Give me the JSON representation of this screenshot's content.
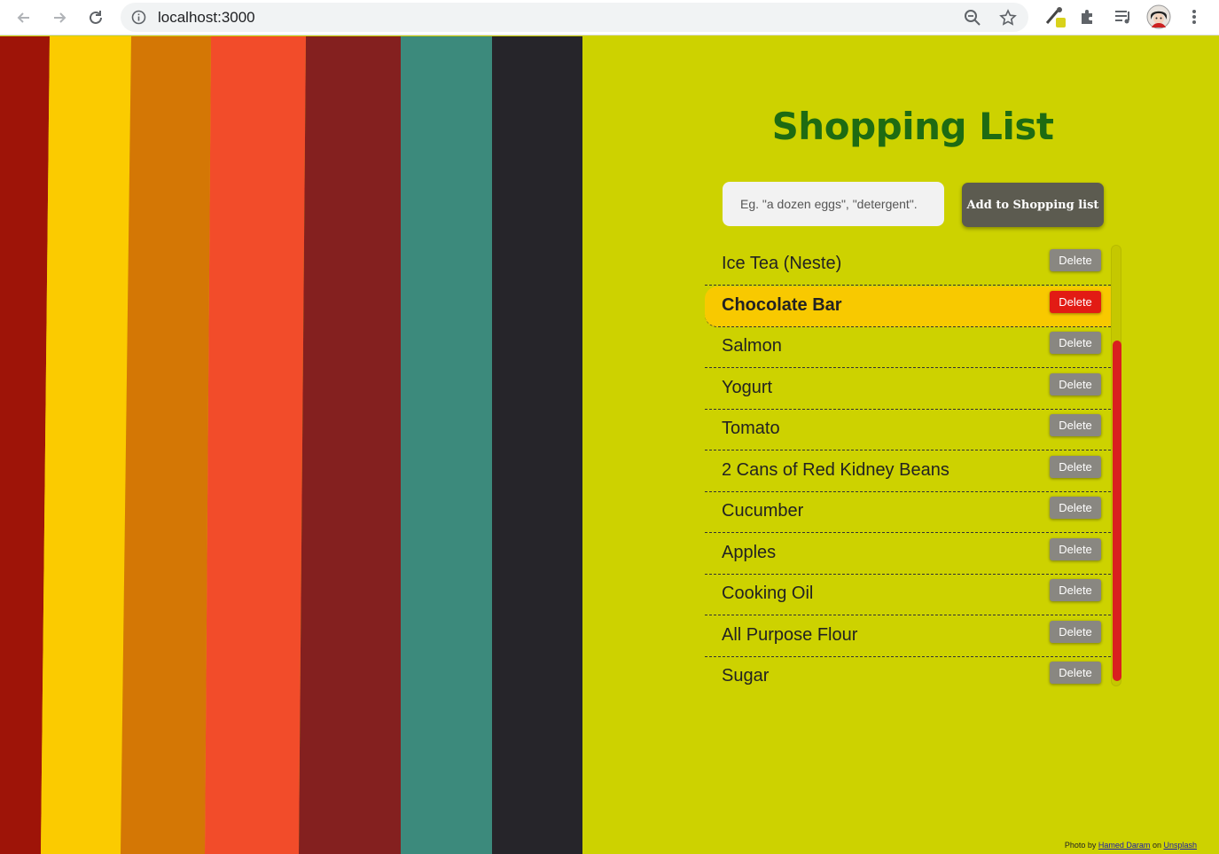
{
  "browser": {
    "url": "localhost:3000",
    "icons": [
      "back-arrow-icon",
      "forward-arrow-icon",
      "reload-icon",
      "info-icon",
      "zoom-icon",
      "star-icon",
      "eyedropper-extension-icon",
      "puzzle-extensions-icon",
      "media-queue-icon",
      "profile-avatar",
      "more-menu-icon"
    ]
  },
  "app": {
    "title": "Shopping List",
    "input_placeholder": "Eg. \"a dozen eggs\", \"detergent\".",
    "add_button": "Add to Shopping list",
    "delete_label": "Delete",
    "selected_color": "#f8c900",
    "delete_selected_color": "#e21b14",
    "title_color": "#1e6b12",
    "background_color": "#cdd200"
  },
  "items": [
    {
      "label": "Ice Tea (Neste)",
      "selected": false
    },
    {
      "label": "Chocolate Bar",
      "selected": true
    },
    {
      "label": "Salmon",
      "selected": false
    },
    {
      "label": "Yogurt",
      "selected": false
    },
    {
      "label": "Tomato",
      "selected": false
    },
    {
      "label": "2 Cans of Red Kidney Beans",
      "selected": false
    },
    {
      "label": "Cucumber",
      "selected": false
    },
    {
      "label": "Apples",
      "selected": false
    },
    {
      "label": "Cooking Oil",
      "selected": false
    },
    {
      "label": "All Purpose Flour",
      "selected": false
    },
    {
      "label": "Sugar",
      "selected": false
    }
  ],
  "credit": {
    "prefix": "Photo by",
    "author": "Hamed Daram",
    "middle": "on",
    "site": "Unsplash"
  },
  "stripe_colors": [
    "#9e1408",
    "#fbcb00",
    "#d47705",
    "#f24c2a",
    "#84201f",
    "#3c8a7c",
    "#26252a"
  ]
}
